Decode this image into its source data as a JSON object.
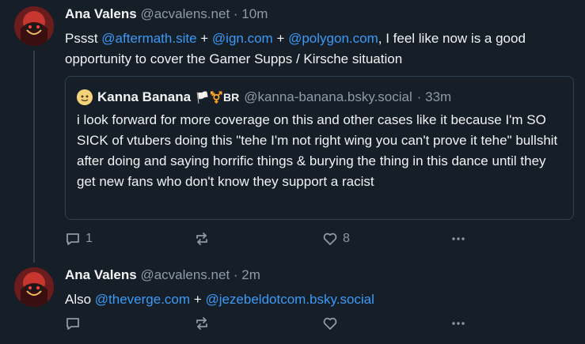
{
  "posts": [
    {
      "author_name": "Ana Valens",
      "author_handle": "@acvalens.net",
      "time": "· 10m",
      "text_parts": [
        "Pssst ",
        "@aftermath.site",
        " + ",
        "@ign.com",
        " + ",
        "@polygon.com",
        ", I feel like now is a good opportunity to cover the Gamer Supps / Kirsche situation"
      ],
      "quote": {
        "author_name": "Kanna Banana",
        "author_flags": "🏳️⚧️BR",
        "author_handle": "@kanna-banana.bsky.social",
        "time": "· 33m",
        "text": "i look forward for more coverage on this and other cases like it because I'm SO SICK of vtubers doing this \"tehe I'm not right wing you can't prove it tehe\" bullshit after doing and saying horrific things & burying the thing in this dance until they get new fans who don't know they support a racist"
      },
      "reply_count": "1",
      "like_count": "8"
    },
    {
      "author_name": "Ana Valens",
      "author_handle": "@acvalens.net",
      "time": "· 2m",
      "text_parts": [
        "Also ",
        "@theverge.com",
        " + ",
        "@jezebeldotcom.bsky.social"
      ]
    }
  ],
  "colors": {
    "background": "#161e27",
    "text": "#f1f3f5",
    "muted": "#8d9aa8",
    "link": "#3b9af8",
    "border": "#2e4052"
  },
  "icons": [
    "reply-icon",
    "repost-icon",
    "like-icon",
    "more-icon"
  ]
}
